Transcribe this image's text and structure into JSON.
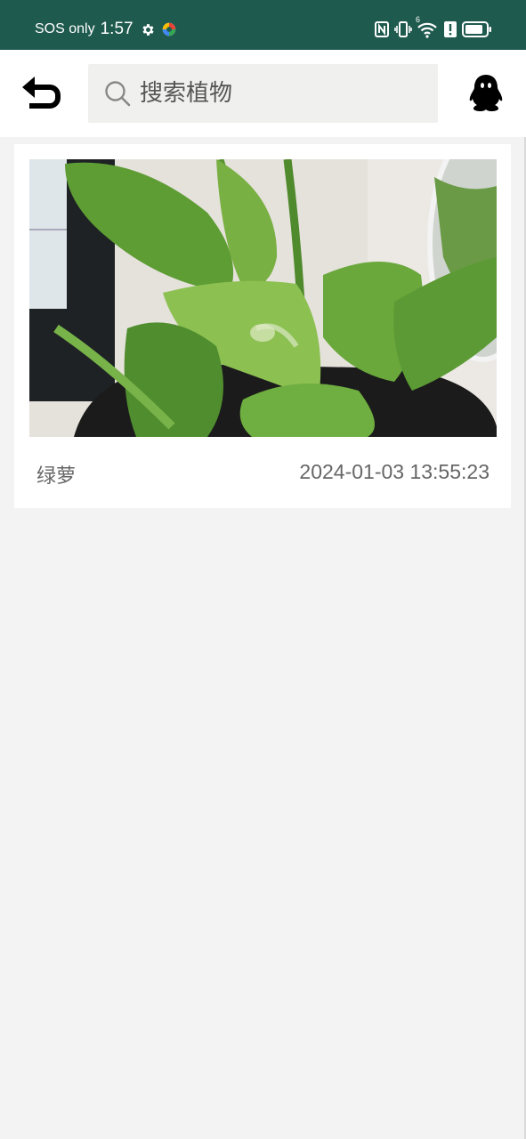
{
  "status_bar": {
    "carrier": "SOS only",
    "time": "1:57",
    "network_label": "6",
    "icons": [
      "gear-icon",
      "app-notification-icon",
      "nfc-icon",
      "vibrate-icon",
      "wifi-icon",
      "alert-icon",
      "battery-icon"
    ]
  },
  "header": {
    "back_icon": "return-arrow-icon",
    "search": {
      "placeholder": "搜索植物",
      "value": ""
    },
    "profile_icon": "qq-penguin-icon"
  },
  "records": [
    {
      "name": "绿萝",
      "timestamp": "2024-01-03 13:55:23",
      "image": "photo-of-potted-pothos-plant"
    }
  ],
  "colors": {
    "status_bar_bg": "#1f5a4e",
    "page_bg": "#f3f3f3",
    "card_bg": "#ffffff",
    "search_bg": "#f0f0ee",
    "secondary_text": "#666666"
  }
}
